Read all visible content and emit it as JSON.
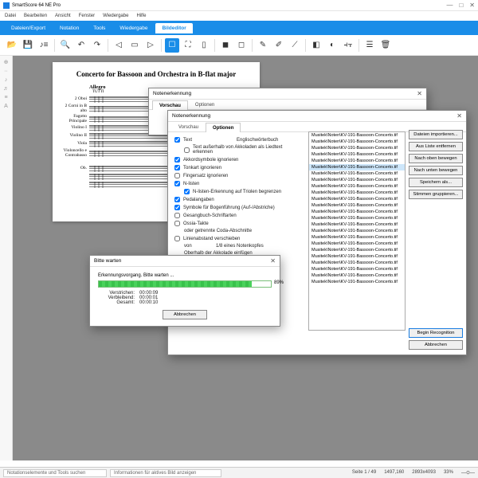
{
  "app": {
    "title": "SmartScore 64 NE Pro"
  },
  "win": {
    "min": "—",
    "max": "□",
    "close": "✕"
  },
  "menu": [
    "Datei",
    "Bearbeiten",
    "Ansicht",
    "Fenster",
    "Wiedergabe",
    "Hilfe"
  ],
  "ribbon": {
    "tabs": [
      "Dateien/Export",
      "Notation",
      "Tools",
      "Wiedergabe",
      "Bildeditor"
    ],
    "active": 4
  },
  "score": {
    "title": "Concerto for Bassoon and Orchestra in B-flat major",
    "tempo": "Allegro",
    "dir": "TUTTI",
    "instruments": [
      "2 Oboi",
      "2 Corni in B alto",
      "Fagotto Principale",
      "Violino I",
      "Violino II",
      "Viola",
      "Violoncello e Contrabasso"
    ],
    "instruments2": [
      "Ob."
    ]
  },
  "recog1": {
    "title": "Notenerkennung",
    "tabs": [
      "Vorschau",
      "Optionen"
    ],
    "file_shown": "Musitek\\Noten\\KV-191-Bassoon-Concerto.tif",
    "btn_import": "Dateien importieren..."
  },
  "recog2": {
    "title": "Notenerkennung",
    "tabs": [
      "Vorschau",
      "Optionen"
    ],
    "opts": {
      "text": "Text",
      "dict": "Englischwörterbuch",
      "text_sub": "Text außerhalb von Akkoladen als Liedtext erkennen",
      "chordsym": "Akkordsymbole ignorieren",
      "tonart": "Tonkart ignorieren",
      "finger": "Fingersatz ignorieren",
      "nlisten": "N-listen",
      "nlisten_sub": "N-listen-Erkennung auf Triolen begrenzen",
      "pedal": "Pedalangaben",
      "bogen": "Symbole für Bogenführung (Auf-/Abstriche)",
      "gesang": "Gesangbuch-Schriftarten",
      "ossia": "Ossia-Takte",
      "coda": "oder getrennte Coda-Abschnitte",
      "line_off": "Linienabstand verschieben",
      "note_head_frac": "1/8 eines Notenkopfes",
      "above_staff": "Oberhalb der Akkolade einfügen"
    },
    "files": [
      "Musitek\\Noten\\KV-191-Bassoon-Concerto.tif",
      "Musitek\\Noten\\KV-191-Bassoon-Concerto.tif",
      "Musitek\\Noten\\KV-191-Bassoon-Concerto.tif",
      "Musitek\\Noten\\KV-191-Bassoon-Concerto.tif",
      "Musitek\\Noten\\KV-191-Bassoon-Concerto.tif",
      "Musitek\\Noten\\KV-191-Bassoon-Concerto.tif",
      "Musitek\\Noten\\KV-191-Bassoon-Concerto.tif",
      "Musitek\\Noten\\KV-191-Bassoon-Concerto.tif",
      "Musitek\\Noten\\KV-191-Bassoon-Concerto.tif",
      "Musitek\\Noten\\KV-191-Bassoon-Concerto.tif",
      "Musitek\\Noten\\KV-191-Bassoon-Concerto.tif",
      "Musitek\\Noten\\KV-191-Bassoon-Concerto.tif",
      "Musitek\\Noten\\KV-191-Bassoon-Concerto.tif",
      "Musitek\\Noten\\KV-191-Bassoon-Concerto.tif",
      "Musitek\\Noten\\KV-191-Bassoon-Concerto.tif",
      "Musitek\\Noten\\KV-191-Bassoon-Concerto.tif",
      "Musitek\\Noten\\KV-191-Bassoon-Concerto.tif",
      "Musitek\\Noten\\KV-191-Bassoon-Concerto.tif",
      "Musitek\\Noten\\KV-191-Bassoon-Concerto.tif",
      "Musitek\\Noten\\KV-191-Bassoon-Concerto.tif",
      "Musitek\\Noten\\KV-191-Bassoon-Concerto.tif",
      "Musitek\\Noten\\KV-191-Bassoon-Concerto.tif",
      "Musitek\\Noten\\KV-191-Bassoon-Concerto.tif",
      "Musitek\\Noten\\KV-191-Bassoon-Concerto.tif"
    ],
    "selected_index": 5,
    "btns": {
      "import": "Dateien importieren...",
      "remove": "Aus Liste entfernen",
      "up": "Nach oben bewegen",
      "down": "Nach unten bewegen",
      "saveas": "Speichern als...",
      "group": "Stimmen gruppieren..."
    },
    "begin": "Begin Recognition",
    "cancel": "Abbrechen"
  },
  "progress": {
    "title": "Bitte warten",
    "status": "Erkennungsvorgang. Bitte warten ...",
    "percent": "89%",
    "elapsed_l": "Verstrichen:",
    "elapsed_v": "00:00:09",
    "remain_l": "Verbleibend:",
    "remain_v": "00:00:01",
    "total_l": "Gesamt:",
    "total_v": "00:00:10",
    "cancel": "Abbrechen"
  },
  "status": {
    "search": "Notationselemente und Tools suchen",
    "info": "Informationen für aktives Bild anzeigen",
    "page": "Seite 1 / 49",
    "cursor": "1497,160",
    "size": "2893x4093",
    "zoom": "33%"
  }
}
